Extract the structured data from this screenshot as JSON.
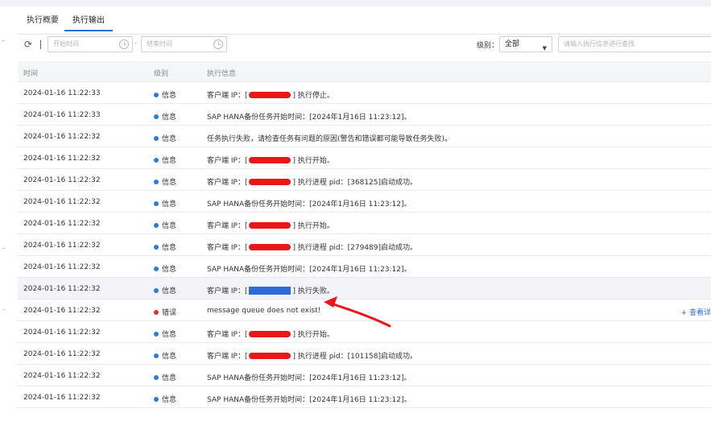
{
  "tabs": [
    {
      "label": "执行概要",
      "active": false
    },
    {
      "label": "执行输出",
      "active": true
    }
  ],
  "toolbar": {
    "start_placeholder": "开始时间",
    "end_placeholder": "结束时间",
    "range_sep": "-",
    "level_label": "级别：",
    "level_value": "全部",
    "search_placeholder": "请输入执行信息进行查找"
  },
  "table": {
    "headers": [
      "时间",
      "级别",
      "执行信息"
    ],
    "rows": [
      {
        "time": "2024-01-16 11:22:33",
        "level": "信息",
        "type": "info",
        "pre": "客户端 IP：[",
        "post": "] 执行停止。",
        "redacted": true
      },
      {
        "time": "2024-01-16 11:22:33",
        "level": "信息",
        "type": "info",
        "pre": "SAP HANA备份任务开始时间：[2024年1月16日 11:23:12]。",
        "post": "",
        "redacted": false
      },
      {
        "time": "2024-01-16 11:22:32",
        "level": "信息",
        "type": "info",
        "pre": "任务执行失败，请检查任务有问题的原因(警告和错误都可能导致任务失败)。",
        "post": "",
        "redacted": false
      },
      {
        "time": "2024-01-16 11:22:32",
        "level": "信息",
        "type": "info",
        "pre": "客户端 IP：[",
        "post": "] 执行开始。",
        "redacted": true
      },
      {
        "time": "2024-01-16 11:22:32",
        "level": "信息",
        "type": "info",
        "pre": "客户端 IP：[",
        "post": "] 执行进程 pid：[368125]启动成功。",
        "redacted": true
      },
      {
        "time": "2024-01-16 11:22:32",
        "level": "信息",
        "type": "info",
        "pre": "SAP HANA备份任务开始时间：[2024年1月16日 11:23:12]。",
        "post": "",
        "redacted": false
      },
      {
        "time": "2024-01-16 11:22:32",
        "level": "信息",
        "type": "info",
        "pre": "客户端 IP：[",
        "post": "] 执行开始。",
        "redacted": true
      },
      {
        "time": "2024-01-16 11:22:32",
        "level": "信息",
        "type": "info",
        "pre": "客户端 IP：[",
        "post": "] 执行进程 pid：[279489]启动成功。",
        "redacted": true
      },
      {
        "time": "2024-01-16 11:22:32",
        "level": "信息",
        "type": "info",
        "pre": "SAP HANA备份任务开始时间：[2024年1月16日 11:23:12]。",
        "post": "",
        "redacted": false
      },
      {
        "time": "2024-01-16 11:22:32",
        "level": "信息",
        "type": "info",
        "pre": "客户端 IP：[",
        "post": "] 执行失败。",
        "redacted": true,
        "boxed": true,
        "highlight": true
      },
      {
        "time": "2024-01-16 11:22:32",
        "level": "错误",
        "type": "error",
        "pre": "message queue does not exist!",
        "post": "",
        "redacted": false,
        "link": "+ 查看详"
      },
      {
        "time": "2024-01-16 11:22:32",
        "level": "信息",
        "type": "info",
        "pre": "客户端 IP：[",
        "post": "] 执行开始。",
        "redacted": true
      },
      {
        "time": "2024-01-16 11:22:32",
        "level": "信息",
        "type": "info",
        "pre": "客户端 IP：[",
        "post": "] 执行进程 pid：[101158]启动成功。",
        "redacted": true
      },
      {
        "time": "2024-01-16 11:22:32",
        "level": "信息",
        "type": "info",
        "pre": "SAP HANA备份任务开始时间：[2024年1月16日 11:23:12]。",
        "post": "",
        "redacted": false
      },
      {
        "time": "2024-01-16 11:22:32",
        "level": "信息",
        "type": "info",
        "pre": "SAP HANA备份任务开始时间：[2024年1月16日 11:23:12]。",
        "post": "",
        "redacted": false
      }
    ]
  },
  "colors": {
    "accent": "#2c6fd8",
    "info_dot": "#2c7be5",
    "error_dot": "#e0302f",
    "annotation": "#e8171a"
  },
  "icons": [
    "refresh-icon",
    "clock-icon",
    "chevron-down-icon",
    "arrow-annotation"
  ]
}
